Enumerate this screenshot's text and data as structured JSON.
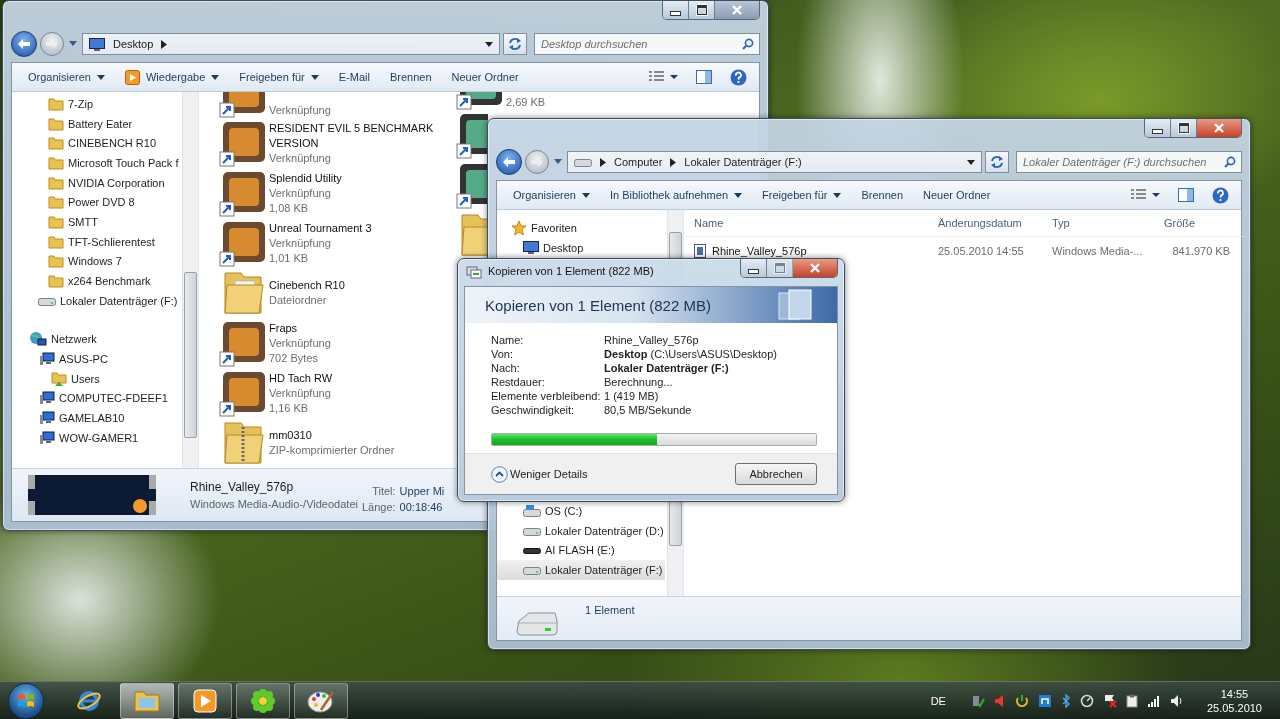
{
  "desktop_explorer": {
    "address": [
      {
        "kind": "crumb",
        "label": "Desktop"
      },
      {
        "kind": "chevron"
      }
    ],
    "search": {
      "placeholder": "Desktop durchsuchen"
    },
    "toolbar": [
      {
        "label": "Organisieren",
        "kind": "menu"
      },
      {
        "label": "Wiedergabe",
        "kind": "play-menu"
      },
      {
        "label": "Freigeben für",
        "kind": "menu"
      },
      {
        "label": "E-Mail",
        "kind": "button"
      },
      {
        "label": "Brennen",
        "kind": "button"
      },
      {
        "label": "Neuer Ordner",
        "kind": "button"
      }
    ],
    "nav": [
      {
        "label": "7-Zip",
        "kind": "folder"
      },
      {
        "label": "Battery Eater",
        "kind": "folder"
      },
      {
        "label": "CINEBENCH R10",
        "kind": "folder"
      },
      {
        "label": "Microsoft Touch Pack f",
        "kind": "folder"
      },
      {
        "label": "NVIDIA Corporation",
        "kind": "folder"
      },
      {
        "label": "Power DVD 8",
        "kind": "folder"
      },
      {
        "label": "SMTT",
        "kind": "folder"
      },
      {
        "label": "TFT-Schlierentest",
        "kind": "folder"
      },
      {
        "label": "Windows 7",
        "kind": "folder"
      },
      {
        "label": "x264 Benchmark",
        "kind": "folder"
      },
      {
        "label": "Lokaler Datenträger (F:)",
        "kind": "drive"
      },
      {
        "label": "Netzwerk",
        "kind": "network",
        "children": [
          {
            "label": "ASUS-PC",
            "kind": "computer",
            "children": [
              {
                "label": "Users",
                "kind": "share"
              }
            ]
          },
          {
            "label": "COMPUTEC-FDEEF1",
            "kind": "computer"
          },
          {
            "label": "GAMELAB10",
            "kind": "computer"
          },
          {
            "label": "WOW-GAMER1",
            "kind": "computer"
          }
        ]
      }
    ],
    "items": [
      {
        "kind": "shortcut",
        "lines": [
          "Verknüpfung"
        ]
      },
      {
        "kind": "shortcut",
        "name": "RESIDENT EVIL 5 BENCHMARK VERSION",
        "lines": [
          "Verknüpfung"
        ]
      },
      {
        "kind": "shortcut",
        "name": "Splendid Utility",
        "lines": [
          "Verknüpfung",
          "1,08 KB"
        ]
      },
      {
        "kind": "shortcut",
        "name": "Unreal Tournament 3",
        "lines": [
          "Verknüpfung",
          "1,01 KB"
        ]
      },
      {
        "kind": "folder",
        "name": "Cinebench R10",
        "lines": [
          "Dateiordner"
        ]
      },
      {
        "kind": "shortcut",
        "name": "Fraps",
        "lines": [
          "Verknüpfung",
          "702 Bytes"
        ]
      },
      {
        "kind": "shortcut",
        "name": "HD Tach RW",
        "lines": [
          "Verknüpfung",
          "1,16 KB"
        ]
      },
      {
        "kind": "zip",
        "name": "mm0310",
        "lines": [
          "ZIP-komprimierter Ordner"
        ]
      }
    ],
    "column_2": [
      {
        "kind": "shortcut",
        "lines": [
          "2,69 KB"
        ]
      },
      {
        "kind": "shortcut"
      },
      {
        "kind": "shortcut"
      },
      {
        "kind": "folder"
      }
    ],
    "details": {
      "name": "Rhine_Valley_576p",
      "type": "Windows Media-Audio-/Videodatei",
      "properties": [
        {
          "label": "Titel:",
          "value": "Upper Mi"
        },
        {
          "label": "Länge:",
          "value": "00:18:46"
        }
      ]
    }
  },
  "drive_explorer": {
    "address": [
      {
        "kind": "chevron"
      },
      {
        "kind": "crumb",
        "label": "Computer"
      },
      {
        "kind": "chevron"
      },
      {
        "kind": "crumb",
        "label": "Lokaler Datenträger (F:)"
      }
    ],
    "search": {
      "placeholder": "Lokaler Datenträger (F:) durchsuchen"
    },
    "toolbar": [
      {
        "label": "Organisieren",
        "kind": "menu"
      },
      {
        "label": "In Bibliothek aufnehmen",
        "kind": "menu"
      },
      {
        "label": "Freigeben für",
        "kind": "menu"
      },
      {
        "label": "Brennen",
        "kind": "button"
      },
      {
        "label": "Neuer Ordner",
        "kind": "button"
      }
    ],
    "favorites": {
      "label": "Favoriten",
      "children": [
        {
          "label": "Desktop",
          "kind": "desktop"
        }
      ]
    },
    "drives": [
      {
        "label": "OS (C:)",
        "kind": "system",
        "selected": false
      },
      {
        "label": "Lokaler Datenträger (D:)",
        "kind": "disk",
        "selected": false
      },
      {
        "label": "AI FLASH (E:)",
        "kind": "flash",
        "selected": false
      },
      {
        "label": "Lokaler Datenträger (F:)",
        "kind": "disk",
        "selected": true
      }
    ],
    "table": {
      "columns": [
        "Name",
        "Änderungsdatum",
        "Typ",
        "Größe"
      ],
      "rows": [
        {
          "cells": [
            "Rhine_Valley_576p",
            "25.05.2010 14:55",
            "Windows Media-...",
            "841.970 KB"
          ]
        }
      ]
    },
    "status": "1 Element"
  },
  "copy_dialog": {
    "title": "Kopieren von 1 Element (822 MB)",
    "heading": "Kopieren von 1 Element (822 MB)",
    "fields": [
      {
        "label": "Name:",
        "value": "Rhine_Valley_576p",
        "emphasis": false
      },
      {
        "label": "Von:",
        "value": "**Desktop** (C:\\Users\\ASUS\\Desktop)",
        "emphasis": false
      },
      {
        "label": "Nach:",
        "value": "Lokaler Datenträger (F:)",
        "emphasis": true
      },
      {
        "label": "Restdauer:",
        "value": "Berechnung...",
        "emphasis": false
      },
      {
        "label": "Elemente verbleibend:",
        "value": "1 (419 MB)",
        "emphasis": false
      },
      {
        "label": "Geschwindigkeit:",
        "value": "80,5 MB/Sekunde",
        "emphasis": false
      }
    ],
    "progress": {
      "level": 0.51
    },
    "details_toggle": "Weniger Details",
    "cancel": "Abbrechen"
  },
  "taskbar": {
    "apps": [
      {
        "kind": "browser",
        "running": false,
        "selected": false
      },
      {
        "kind": "explorer",
        "running": true,
        "selected": true
      },
      {
        "kind": "media",
        "running": true,
        "selected": false
      },
      {
        "kind": "messenger",
        "running": true,
        "selected": false
      },
      {
        "kind": "paint",
        "running": true,
        "selected": false
      }
    ],
    "language": "DE",
    "time": "14:55",
    "date": "25.05.2010"
  }
}
